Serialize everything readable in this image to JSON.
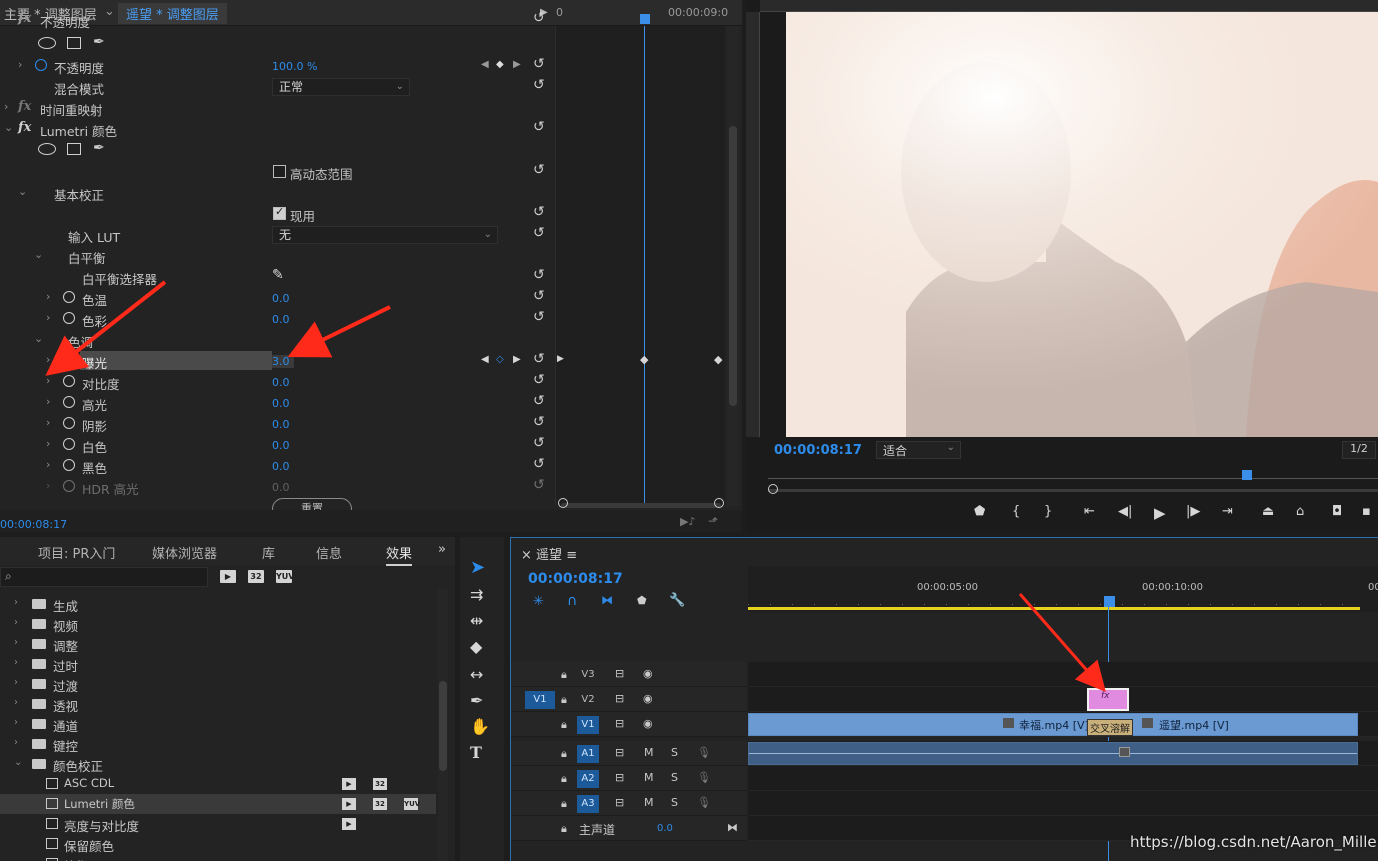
{
  "effect_controls": {
    "tab_main": "主要 * 调整图层",
    "tab_seq": "遥望 * 调整图层",
    "tab_time_zero": "0",
    "tab_time_end": "00:00:09:0",
    "opacity_section": "不透明度",
    "opacity_label": "不透明度",
    "opacity_value": "100.0 %",
    "blend_label": "混合模式",
    "blend_value": "正常",
    "time_remap": "时间重映射",
    "lumetri": "Lumetri 颜色",
    "hdr_label": "高动态范围",
    "basic_correction": "基本校正",
    "apply_label": "现用",
    "input_lut_label": "输入 LUT",
    "input_lut_value": "无",
    "white_balance": "白平衡",
    "wb_selector": "白平衡选择器",
    "temp_label": "色温",
    "temp_value": "0.0",
    "tint_label": "色彩",
    "tint_value": "0.0",
    "tone_label": "色调",
    "exposure_label": "曝光",
    "exposure_value": "3.0",
    "contrast_label": "对比度",
    "contrast_value": "0.0",
    "highlight_label": "高光",
    "highlight_value": "0.0",
    "shadow_label": "阴影",
    "shadow_value": "0.0",
    "white_label": "白色",
    "white_value": "0.0",
    "black_label": "黑色",
    "black_value": "0.0",
    "hdr_highlight_label": "HDR 高光",
    "hdr_highlight_value": "0.0",
    "reset_button": "重置",
    "current_time": "00:00:08:17"
  },
  "program_monitor": {
    "timecode": "00:00:08:17",
    "fit_value": "适合",
    "resolution": "1/2"
  },
  "project_panel": {
    "tabs": [
      "项目: PR入门",
      "媒体浏览器",
      "库",
      "信息",
      "效果"
    ],
    "active_tab": "效果",
    "tree": [
      {
        "label": "生成",
        "type": "folder"
      },
      {
        "label": "视频",
        "type": "folder"
      },
      {
        "label": "调整",
        "type": "folder"
      },
      {
        "label": "过时",
        "type": "folder"
      },
      {
        "label": "过渡",
        "type": "folder"
      },
      {
        "label": "透视",
        "type": "folder"
      },
      {
        "label": "通道",
        "type": "folder"
      },
      {
        "label": "键控",
        "type": "folder"
      },
      {
        "label": "颜色校正",
        "type": "folder"
      },
      {
        "label": "ASC CDL",
        "type": "effect"
      },
      {
        "label": "Lumetri 颜色",
        "type": "effect"
      },
      {
        "label": "亮度与对比度",
        "type": "effect"
      },
      {
        "label": "保留颜色",
        "type": "effect"
      },
      {
        "label": "均衡",
        "type": "effect"
      }
    ]
  },
  "timeline": {
    "sequence_name": "遥望",
    "timecode": "00:00:08:17",
    "ruler_labels": [
      "00:00:05:00",
      "00:00:10:00",
      "00"
    ],
    "tracks": {
      "v3": "V3",
      "v2": "V2",
      "v1": "V1",
      "a1": "A1",
      "a2": "A2",
      "a3": "A3",
      "master": "主声道",
      "master_value": "0.0",
      "source_v1": "V1",
      "m": "M",
      "s": "S"
    },
    "clips": {
      "clip1": "幸福.mp4 [V]",
      "transition": "交叉溶解",
      "clip2": "遥望.mp4 [V]",
      "fx": "fx"
    }
  },
  "watermark": "https://blog.csdn.net/Aaron_Miller",
  "colors": {
    "accent_blue": "#2d8ceb",
    "work_area": "#e6d21c",
    "clip_video": "#6b9ad3",
    "clip_adjust": "#e08ae0",
    "annotation_red": "#ff2a1a"
  }
}
